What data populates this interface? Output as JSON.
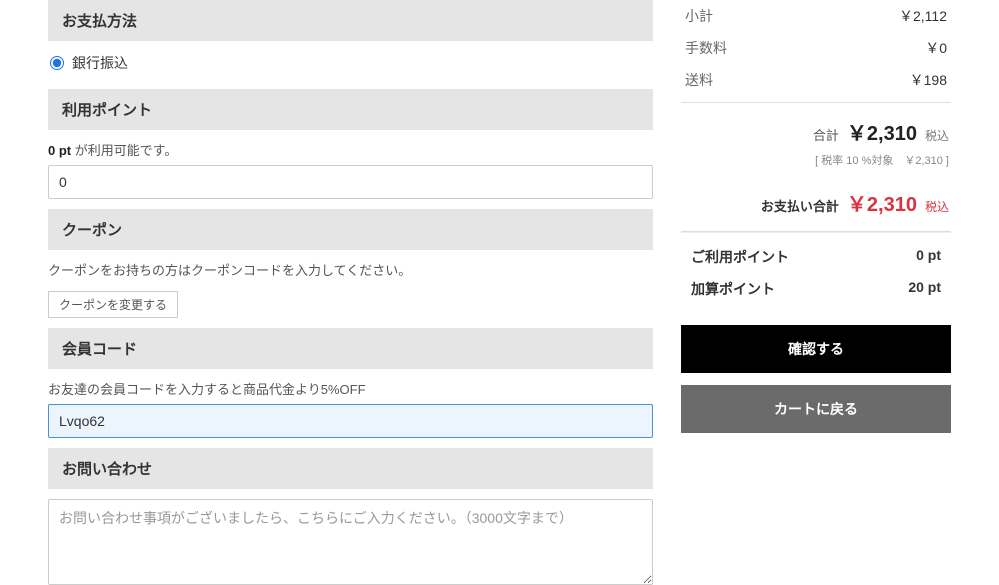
{
  "payment": {
    "header": "お支払方法",
    "options": [
      {
        "label": "銀行振込",
        "checked": true
      }
    ]
  },
  "points": {
    "header": "利用ポイント",
    "available_prefix": "0 pt",
    "available_suffix": " が利用可能です。",
    "input_value": "0"
  },
  "coupon": {
    "header": "クーポン",
    "hint": "クーポンをお持ちの方はクーポンコードを入力してください。",
    "change_button": "クーポンを変更する"
  },
  "member_code": {
    "header": "会員コード",
    "hint": "お友達の会員コードを入力すると商品代金より5%OFF",
    "input_value": "Lvqo62"
  },
  "inquiry": {
    "header": "お問い合わせ",
    "placeholder": "お問い合わせ事項がございましたら、こちらにご入力ください。（3000文字まで）"
  },
  "summary": {
    "subtotal_label": "小計",
    "subtotal_value": "￥2,112",
    "fee_label": "手数料",
    "fee_value": "￥0",
    "shipping_label": "送料",
    "shipping_value": "￥198",
    "total_label": "合計",
    "total_value": "￥2,310",
    "total_tax": "税込",
    "tax_detail": "[ 税率 10 %対象　￥2,310 ]",
    "pay_total_label": "お支払い合計",
    "pay_total_value": "￥2,310",
    "pay_total_tax": "税込",
    "used_points_label": "ご利用ポイント",
    "used_points_value": "0 pt",
    "earn_points_label": "加算ポイント",
    "earn_points_value": "20 pt",
    "confirm_button": "確認する",
    "back_button": "カートに戻る"
  }
}
